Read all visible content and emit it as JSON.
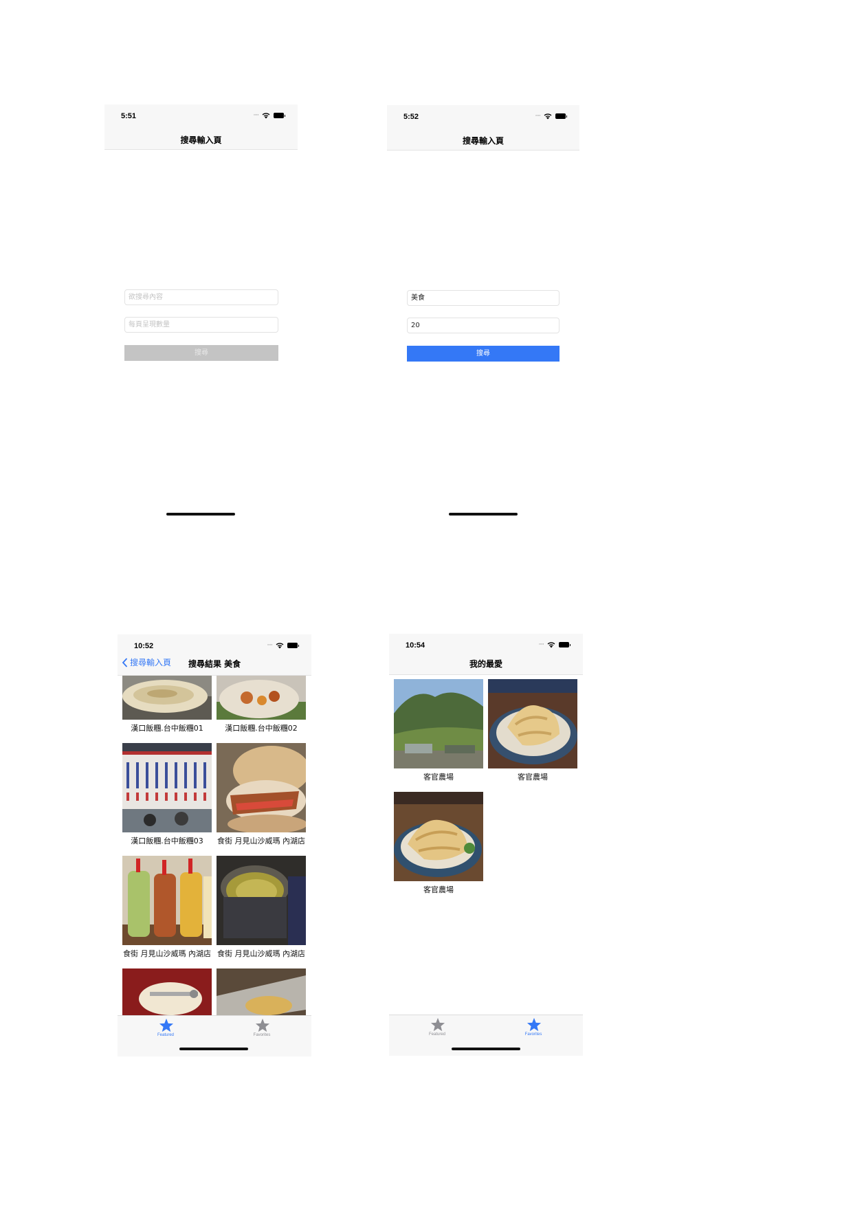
{
  "screen1": {
    "status_time": "5:51",
    "nav_title": "搜尋輸入頁",
    "search_placeholder": "欲搜尋內容",
    "count_placeholder": "每頁呈現數量",
    "search_button": "搜尋",
    "search_button_state": "disabled"
  },
  "screen2": {
    "status_time": "5:52",
    "nav_title": "搜尋輸入頁",
    "search_value": "美食",
    "count_value": "20",
    "search_button": "搜尋",
    "search_button_state": "enabled"
  },
  "screen3": {
    "status_time": "10:52",
    "back_label": "搜尋輸入頁",
    "nav_title": "搜尋結果 美食",
    "items": [
      {
        "caption": "漢口飯糰.台中飯糰01",
        "image": "scallion-pancake-photo"
      },
      {
        "caption": "漢口飯糰.台中飯糰02",
        "image": "rice-roll-photo"
      },
      {
        "caption": "漢口飯糰.台中飯糰03",
        "image": "menu-board-photo"
      },
      {
        "caption": "食街 月見山沙威瑪 內湖店",
        "image": "shawarma-photo"
      },
      {
        "caption": "食街 月見山沙威瑪 內湖店",
        "image": "sauce-bottles-photo"
      },
      {
        "caption": "食街 月見山沙威瑪 內湖店",
        "image": "spice-tin-photo"
      },
      {
        "caption": "",
        "image": "grill-photo"
      },
      {
        "caption": "",
        "image": "pita-photo"
      }
    ],
    "tabs": [
      {
        "label": "Featured",
        "icon": "star-icon",
        "selected": true
      },
      {
        "label": "Favorites",
        "icon": "star-icon",
        "selected": false
      }
    ]
  },
  "screen4": {
    "status_time": "10:54",
    "nav_title": "我的最愛",
    "items": [
      {
        "caption": "客官農場",
        "image": "mountain-farm-photo"
      },
      {
        "caption": "客官農場",
        "image": "chicken-plate-photo"
      },
      {
        "caption": "客官農場",
        "image": "chicken-plate-photo"
      }
    ],
    "tabs": [
      {
        "label": "Featured",
        "icon": "star-icon",
        "selected": false
      },
      {
        "label": "Favorites",
        "icon": "star-icon",
        "selected": true
      }
    ]
  },
  "colors": {
    "accent": "#3478f6",
    "disabled": "#c4c4c4",
    "navbar": "#f7f7f7",
    "tab_inactive": "#8e8e93"
  }
}
